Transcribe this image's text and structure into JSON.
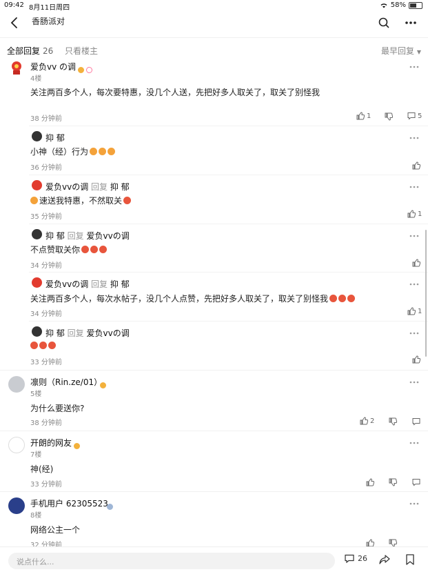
{
  "status": {
    "time": "09:42",
    "date": "8月11日周四",
    "battery": "58%"
  },
  "header": {
    "title": "香肠派对"
  },
  "tabs": {
    "all_label": "全部回复",
    "all_count": "26",
    "op_only": "只看楼主",
    "sort": "最早回复"
  },
  "posts": [
    {
      "user": "爱负vv の调",
      "floor": "4楼",
      "text": "关注两百多个人，每次要特惠，没几个人送，先把好多人取关了，取关了别怪我",
      "time": "38 分钟前",
      "likes": "1",
      "comments": "5"
    },
    {
      "user": "凛则（Rin.ze/01）",
      "floor": "5楼",
      "text": "为什么要送你?",
      "time": "38 分钟前",
      "likes": "2"
    },
    {
      "user": "开朗的网友",
      "floor": "7楼",
      "text": "神(经)",
      "time": "33 分钟前"
    },
    {
      "user": "手机用户 62305523",
      "floor": "8楼",
      "text": "网络公主一个",
      "time": "32 分钟前"
    }
  ],
  "replies": [
    {
      "user": "抑 郁",
      "reply_word": "",
      "target": "",
      "text": "小神（经）行为",
      "time": "36 分钟前",
      "likes": ""
    },
    {
      "user": "爱负vvの调",
      "reply_word": "回复",
      "target": "抑 郁",
      "text": "速送我特惠，不然取关",
      "time": "35 分钟前",
      "likes": "1"
    },
    {
      "user": "抑 郁",
      "reply_word": "回复",
      "target": "爱负vvの调",
      "text": "不点赞取关你",
      "time": "34 分钟前",
      "likes": ""
    },
    {
      "user": "爱负vvの调",
      "reply_word": "回复",
      "target": "抑 郁",
      "text": "关注两百多个人，每次水帖子，没几个人点赞，先把好多人取关了，取关了别怪我",
      "time": "34 分钟前",
      "likes": "1"
    },
    {
      "user": "抑 郁",
      "reply_word": "回复",
      "target": "爱负vvの调",
      "text": "",
      "time": "33 分钟前",
      "likes": ""
    }
  ],
  "bottom": {
    "placeholder": "说点什么...",
    "comment_count": "26"
  },
  "colors": {
    "accent_fire": "#f4a23a",
    "angry_emoji": "#e8553c",
    "text_grey": "#888888"
  }
}
